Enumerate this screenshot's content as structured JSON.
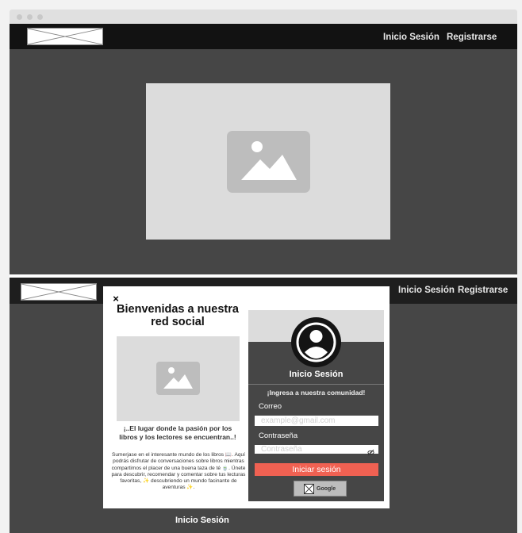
{
  "nav_top": {
    "login_link": "Inicio Sesión",
    "register_link": "Registrarse"
  },
  "nav_bottom": {
    "login_link": "Inicio Sesión",
    "register_link": "Registrarse"
  },
  "modal": {
    "close_label": "×",
    "welcome_title": "Bienvenidas a nuestra red social",
    "tagline": "¡..El lugar donde la pasión por los libros y los lectores se encuentran..!",
    "description": "Sumerjase en el interesante mundo de los libros 📖. Aquí podrás disfrutar de conversaciones sobre libros mientras compartimos el placer de una buena taza de té 🍵. Únete para descubrir, recomendar y comentar sobre tus lecturas favoritas, ✨ descubriendo un mundo facinante de aventuras ✨.",
    "login_panel": {
      "title": "Inicio Sesión",
      "subtitle": "¡Ingresa a nuestra comunidad!",
      "email_label": "Correo",
      "email_placeholder": "example@gmail.com",
      "password_label": "Contraseña",
      "password_placeholder": "Contraseña",
      "submit_label": "Iniciar sesión",
      "google_label": "Google"
    }
  },
  "footer_link": "Inicio Sesión",
  "colors": {
    "navbar": "#121212",
    "background": "#464646",
    "placeholder_image": "#dcdcdc",
    "accent_button": "#f06152"
  }
}
